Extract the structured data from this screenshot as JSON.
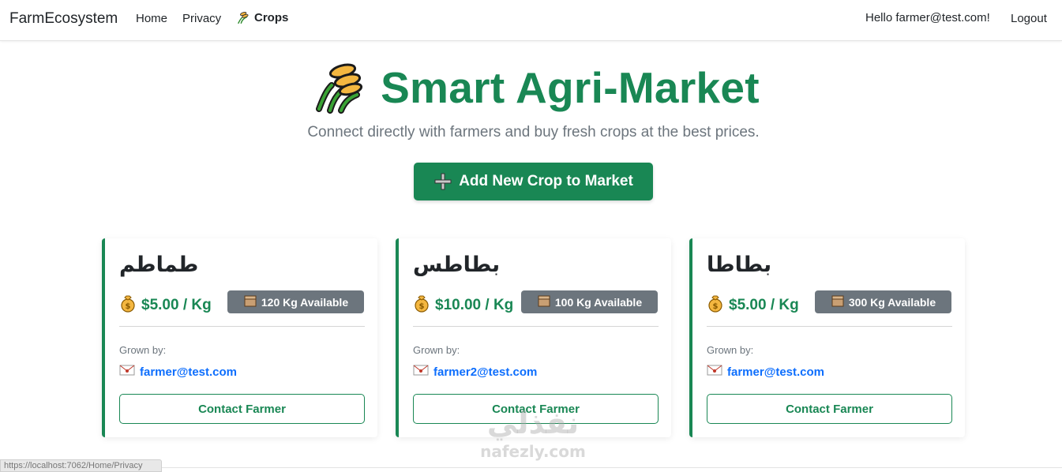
{
  "nav": {
    "brand": "FarmEcosystem",
    "links": [
      {
        "label": "Home"
      },
      {
        "label": "Privacy"
      },
      {
        "label": "Crops",
        "icon": "wheat-icon"
      }
    ],
    "greeting": "Hello farmer@test.com!",
    "logout": "Logout"
  },
  "hero": {
    "title": "Smart Agri-Market",
    "icon": "wheat-icon",
    "subtitle": "Connect directly with farmers and buy fresh crops at the best prices.",
    "add_button": "Add New Crop to Market"
  },
  "cards": [
    {
      "name": "طماطم",
      "price": "$5.00 / Kg",
      "stock": "120 Kg Available",
      "grown_by_label": "Grown by:",
      "farmer": "farmer@test.com",
      "contact_label": "Contact Farmer"
    },
    {
      "name": "بطاطس",
      "price": "$10.00 / Kg",
      "stock": "100 Kg Available",
      "grown_by_label": "Grown by:",
      "farmer": "farmer2@test.com",
      "contact_label": "Contact Farmer"
    },
    {
      "name": "بطاطا",
      "price": "$5.00 / Kg",
      "stock": "300 Kg Available",
      "grown_by_label": "Grown by:",
      "farmer": "farmer@test.com",
      "contact_label": "Contact Farmer"
    }
  ],
  "status_bar": {
    "url": "https://localhost:7062/Home/Privacy"
  },
  "watermark": {
    "arabic": "نفذلي",
    "latin": "nafezly.com"
  },
  "colors": {
    "accent": "#198754",
    "link": "#0d6efd",
    "badge": "#6c757d"
  }
}
